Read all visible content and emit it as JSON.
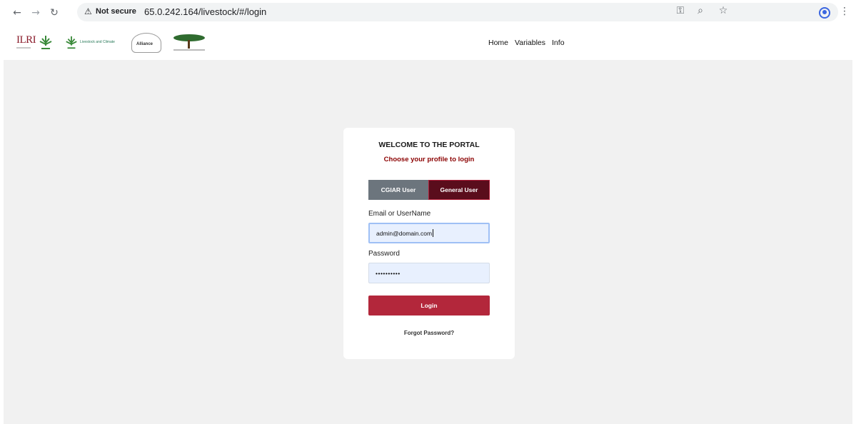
{
  "browser": {
    "security_label": "Not secure",
    "url": "65.0.242.164/livestock/#/login"
  },
  "header": {
    "logos": {
      "ilri": "ILRI",
      "cgiar_lc": "Livestock and Climate",
      "alliance": "Alliance"
    },
    "nav": [
      "Home",
      "Variables",
      "Info"
    ]
  },
  "login": {
    "title": "WELCOME TO THE PORTAL",
    "subtitle": "Choose your profile to login",
    "tabs": [
      "CGIAR User",
      "General User"
    ],
    "email_label": "Email or UserName",
    "email_value": "admin@domain.com",
    "password_label": "Password",
    "password_value": "••••••••••",
    "login_button": "Login",
    "forgot_link": "Forgot Password?"
  },
  "colors": {
    "accent_red": "#b3273b",
    "active_tab": "#5a0d1c",
    "inactive_tab": "#6c757d",
    "subtitle": "#8b0000"
  }
}
